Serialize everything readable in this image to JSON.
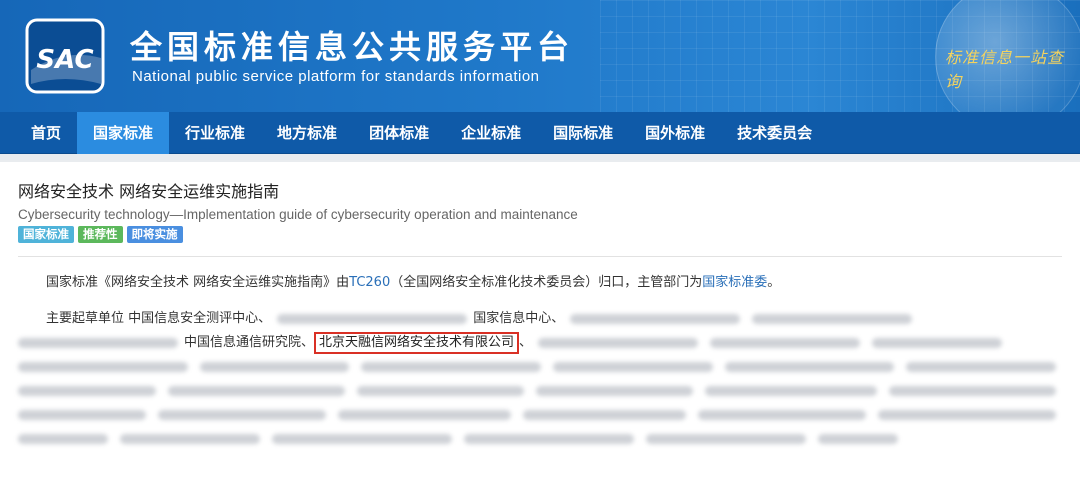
{
  "header": {
    "title_cn": "全国标准信息公共服务平台",
    "title_en": "National public service platform  for standards information",
    "logo_text": "SAC",
    "slogan": "标准信息一站查询"
  },
  "nav": {
    "items": [
      "首页",
      "国家标准",
      "行业标准",
      "地方标准",
      "团体标准",
      "企业标准",
      "国际标准",
      "国外标准",
      "技术委员会"
    ],
    "active_index": 1
  },
  "standard": {
    "title_cn": "网络安全技术 网络安全运维实施指南",
    "title_en": "Cybersecurity technology—Implementation guide of cybersecurity operation and maintenance",
    "badges": [
      {
        "label": "国家标准",
        "color": "#4fb3d9"
      },
      {
        "label": "推荐性",
        "color": "#5cb85c"
      },
      {
        "label": "即将实施",
        "color": "#4a8fe0"
      }
    ]
  },
  "description": {
    "prefix": "国家标准《网络安全技术 网络安全运维实施指南》由",
    "tc_link": "TC260",
    "tc_name": "（全国网络安全标准化技术委员会）归口，主管部门为",
    "authority_link": "国家标准委",
    "suffix": "。"
  },
  "drafters": {
    "label": "主要起草单位",
    "unit_1": "中国信息安全测评中心",
    "unit_2": "国家信息中心",
    "unit_3": "中国信息通信研究院",
    "highlighted_unit": "北京天融信网络安全技术有限公司",
    "separator": "、"
  },
  "colors": {
    "header_bg": "#1f78c9",
    "nav_bg": "#0f5aa8",
    "nav_active": "#2b8ce0",
    "link": "#2a6fb8",
    "highlight_border": "#d93025"
  }
}
